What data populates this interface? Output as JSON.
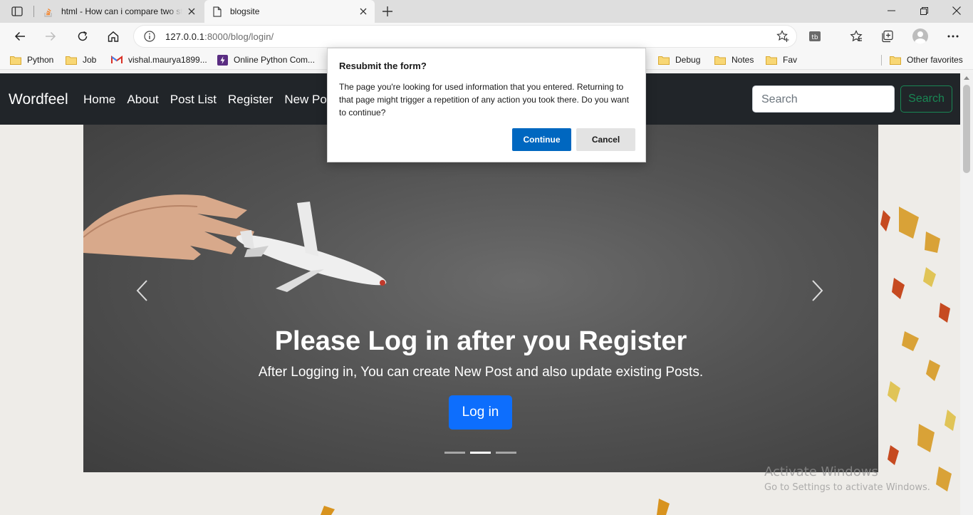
{
  "browser": {
    "tabs": [
      {
        "title": "html - How can i compare two strings",
        "favicon": "stackoverflow-icon"
      },
      {
        "title": "blogsite",
        "favicon": "page-icon",
        "active": true
      }
    ],
    "address": {
      "host": "127.0.0.1",
      "rest": ":8000/blog/login/"
    },
    "bookmarks": [
      {
        "label": "Python",
        "icon": "folder-icon"
      },
      {
        "label": "Job",
        "icon": "folder-icon"
      },
      {
        "label": "vishal.maurya1899...",
        "icon": "gmail-icon"
      },
      {
        "label": "Online Python Com...",
        "icon": "replit-icon"
      },
      {
        "label": "Debug",
        "icon": "folder-icon"
      },
      {
        "label": "Notes",
        "icon": "folder-icon"
      },
      {
        "label": "Fav",
        "icon": "folder-icon"
      },
      {
        "label": "Other favorites",
        "icon": "folder-icon"
      }
    ]
  },
  "dialog": {
    "title": "Resubmit the form?",
    "message": "The page you're looking for used information that you entered. Returning to that page might trigger a repetition of any action you took there. Do you want to continue?",
    "continue_label": "Continue",
    "cancel_label": "Cancel"
  },
  "site": {
    "brand": "Wordfeel",
    "nav": [
      "Home",
      "About",
      "Post List",
      "Register",
      "New Post"
    ],
    "search_placeholder": "Search",
    "search_button": "Search",
    "carousel": {
      "title": "Please Log in after you Register",
      "subtitle": "After Logging in, You can create New Post and also update existing Posts.",
      "button": "Log in",
      "active_slide": 2,
      "slide_count": 3
    }
  },
  "watermark": {
    "line1": "Activate Windows",
    "line2": "Go to Settings to activate Windows."
  },
  "colors": {
    "navbar": "#212529",
    "primary": "#0d6efd",
    "success": "#198754",
    "dialog_continue": "#0067c0"
  }
}
